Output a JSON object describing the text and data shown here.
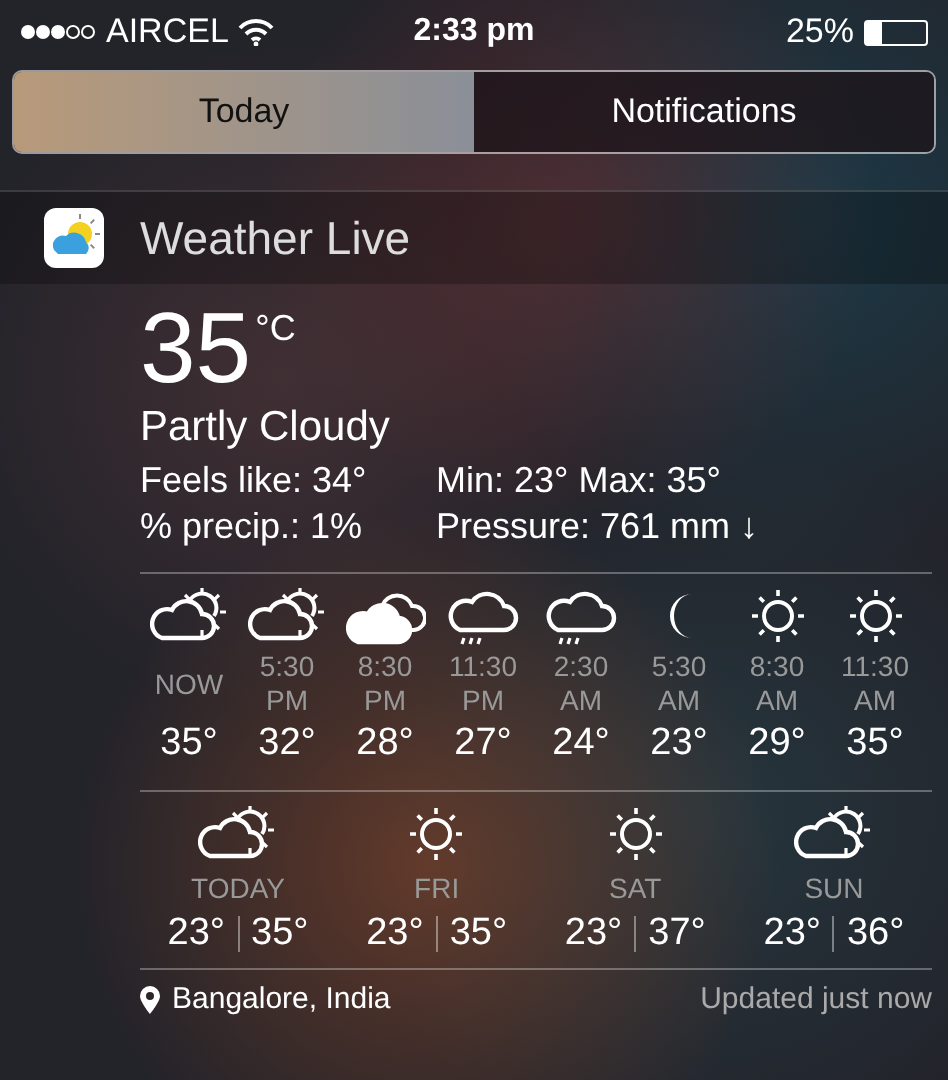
{
  "status_bar": {
    "carrier": "AIRCEL",
    "time": "2:33 pm",
    "battery": "25%"
  },
  "tabs": [
    {
      "label": "Today",
      "selected": true
    },
    {
      "label": "Notifications",
      "selected": false
    }
  ],
  "widget": {
    "title": "Weather Live",
    "temperature": "35",
    "unit": "°C",
    "condition": "Partly Cloudy",
    "details": [
      {
        "label": "Feels like: 34°",
        "value": "Min: 23° Max: 35°"
      },
      {
        "label": "% precip.: 1%",
        "value": "Pressure: 761 mm ↓"
      }
    ],
    "hourly": [
      {
        "time": "NOW",
        "temp": "35°",
        "kind": "partly-cloudy"
      },
      {
        "time": "5:30 PM",
        "temp": "32°",
        "kind": "partly-cloudy"
      },
      {
        "time": "8:30 PM",
        "temp": "28°",
        "kind": "cloudy"
      },
      {
        "time": "11:30 PM",
        "temp": "27°",
        "kind": "rain"
      },
      {
        "time": "2:30 AM",
        "temp": "24°",
        "kind": "rain"
      },
      {
        "time": "5:30 AM",
        "temp": "23°",
        "kind": "moon"
      },
      {
        "time": "8:30 AM",
        "temp": "29°",
        "kind": "sun"
      },
      {
        "time": "11:30 AM",
        "temp": "35°",
        "kind": "sun"
      }
    ],
    "daily": [
      {
        "day": "TODAY",
        "low": "23°",
        "high": "35°",
        "kind": "partly-cloudy"
      },
      {
        "day": "FRI",
        "low": "23°",
        "high": "35°",
        "kind": "sun"
      },
      {
        "day": "SAT",
        "low": "23°",
        "high": "37°",
        "kind": "sun"
      },
      {
        "day": "SUN",
        "low": "23°",
        "high": "36°",
        "kind": "partly-cloudy"
      }
    ],
    "location": "Bangalore, India",
    "updated": "Updated just now"
  }
}
